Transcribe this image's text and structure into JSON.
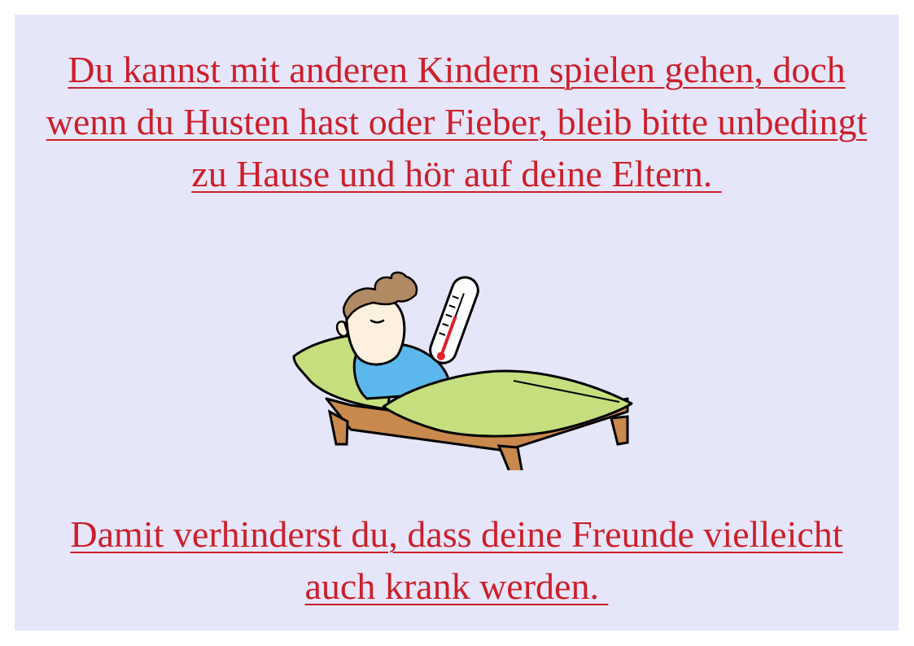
{
  "slide": {
    "top_text_lines": [
      "Du kannst mit anderen Kindern spielen gehen, doch",
      "wenn du Husten hast oder Fieber, bleib bitte unbedingt",
      "zu Hause und hör auf deine Eltern. "
    ],
    "bottom_text_lines": [
      "Damit verhinderst du, dass deine Freunde vielleicht",
      "auch krank werden. "
    ],
    "illustration_icon": "sick-child-in-bed-with-thermometer-icon",
    "colors": {
      "background": "#e6e6fb",
      "text": "#cc1f2a"
    }
  }
}
